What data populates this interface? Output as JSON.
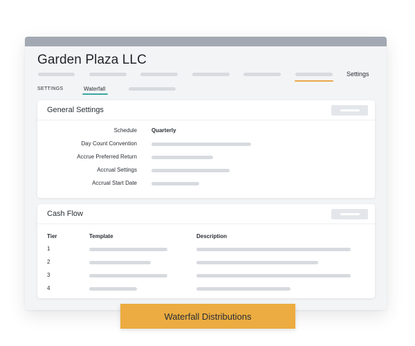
{
  "app": {
    "title": "Garden Plaza LLC"
  },
  "nav": {
    "active_label": "Settings"
  },
  "subnav": {
    "section_label": "SETTINGS",
    "active_tab": "Waterfall"
  },
  "general_settings": {
    "title": "General Settings",
    "rows": [
      {
        "label": "Schedule",
        "value": "Quarterly"
      },
      {
        "label": "Day Count Convention",
        "value": ""
      },
      {
        "label": "Accrue Preferred Return",
        "value": ""
      },
      {
        "label": "Accrual Settings",
        "value": ""
      },
      {
        "label": "Accrual Start Date",
        "value": ""
      }
    ]
  },
  "cash_flow": {
    "title": "Cash Flow",
    "columns": [
      "Tier",
      "Template",
      "Description"
    ],
    "tiers": [
      "1",
      "2",
      "3",
      "4"
    ]
  },
  "banner": {
    "label": "Waterfall Distributions"
  },
  "colors": {
    "titlebar": "#a3a9b3",
    "nav_accent": "#e8a84b",
    "tab_accent": "#3aa6a1",
    "banner": "#ecac41",
    "placeholder": "#d7dadf"
  }
}
